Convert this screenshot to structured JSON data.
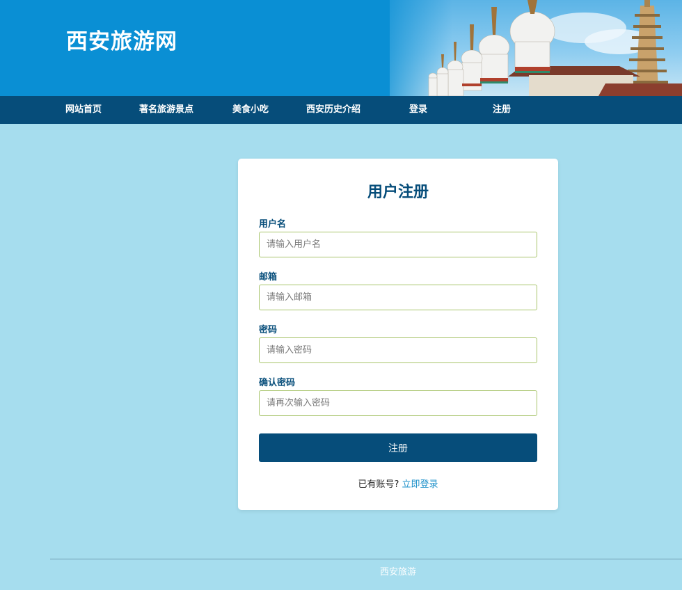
{
  "header": {
    "site_title": "西安旅游网"
  },
  "nav": {
    "items": [
      {
        "label": "网站首页"
      },
      {
        "label": "著名旅游景点"
      },
      {
        "label": "美食小吃"
      },
      {
        "label": "西安历史介绍"
      },
      {
        "label": "登录"
      },
      {
        "label": "注册"
      }
    ]
  },
  "form": {
    "title": "用户注册",
    "fields": [
      {
        "label": "用户名",
        "placeholder": "请输入用户名",
        "value": ""
      },
      {
        "label": "邮箱",
        "placeholder": "请输入邮箱",
        "value": ""
      },
      {
        "label": "密码",
        "placeholder": "请输入密码",
        "value": ""
      },
      {
        "label": "确认密码",
        "placeholder": "请再次输入密码",
        "value": ""
      }
    ],
    "submit_label": "注册",
    "login_prompt": "已有账号?",
    "login_link": "立即登录"
  },
  "footer": {
    "text": "西安旅游"
  },
  "colors": {
    "primary": "#064d7a",
    "background": "#a6ddee",
    "banner": "#0a8fd4",
    "input_border": "#a7c46a",
    "link": "#1a8fc9"
  }
}
